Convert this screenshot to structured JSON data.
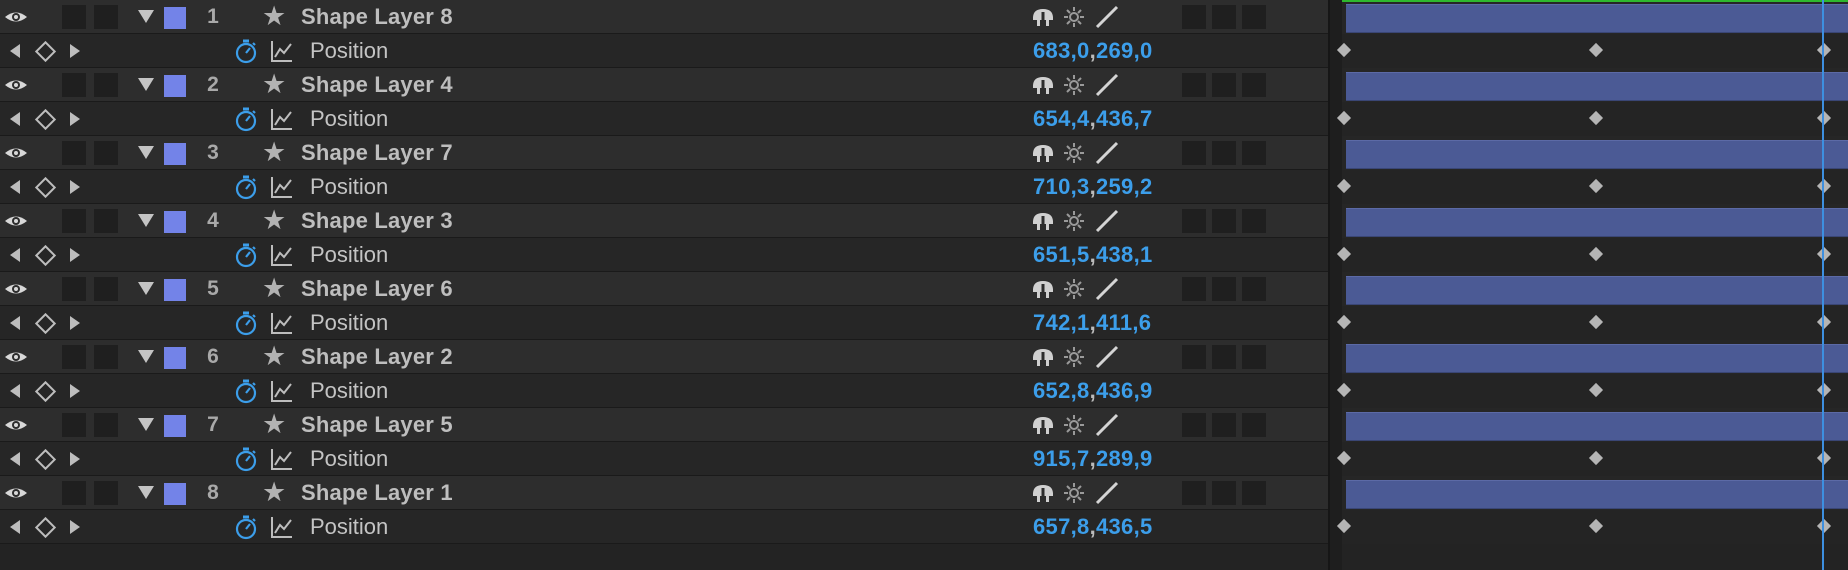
{
  "layers": [
    {
      "index": "1",
      "name": "Shape Layer 8",
      "property": "Position",
      "x": "683,0",
      "y": "269,0",
      "separator": ","
    },
    {
      "index": "2",
      "name": "Shape Layer 4",
      "property": "Position",
      "x": "654,4",
      "y": "436,7",
      "separator": ","
    },
    {
      "index": "3",
      "name": "Shape Layer 7",
      "property": "Position",
      "x": "710,3",
      "y": "259,2",
      "separator": ","
    },
    {
      "index": "4",
      "name": "Shape Layer 3",
      "property": "Position",
      "x": "651,5",
      "y": "438,1",
      "separator": ","
    },
    {
      "index": "5",
      "name": "Shape Layer 6",
      "property": "Position",
      "x": "742,1",
      "y": "411,6",
      "separator": ","
    },
    {
      "index": "6",
      "name": "Shape Layer 2",
      "property": "Position",
      "x": "652,8",
      "y": "436,9",
      "separator": ","
    },
    {
      "index": "7",
      "name": "Shape Layer 5",
      "property": "Position",
      "x": "915,7",
      "y": "289,9",
      "separator": ","
    },
    {
      "index": "8",
      "name": "Shape Layer 1",
      "property": "Position",
      "x": "657,8",
      "y": "436,5",
      "separator": ","
    }
  ],
  "colors": {
    "label_chip": "#7383e8",
    "layer_bar": "#4b5a95",
    "value_text": "#3c9eea",
    "playhead": "#3d8fe0",
    "work_area": "#2eb82e"
  },
  "icons": {
    "visibility": "eye-icon",
    "twirl": "twirl-down-icon",
    "layer_type": "star-icon",
    "shy": "shy-icon",
    "collapse": "sun-icon",
    "quality": "quality-slash-icon",
    "stopwatch": "stopwatch-icon",
    "graph": "graph-icon",
    "keyframe": "keyframe-diamond-icon"
  }
}
